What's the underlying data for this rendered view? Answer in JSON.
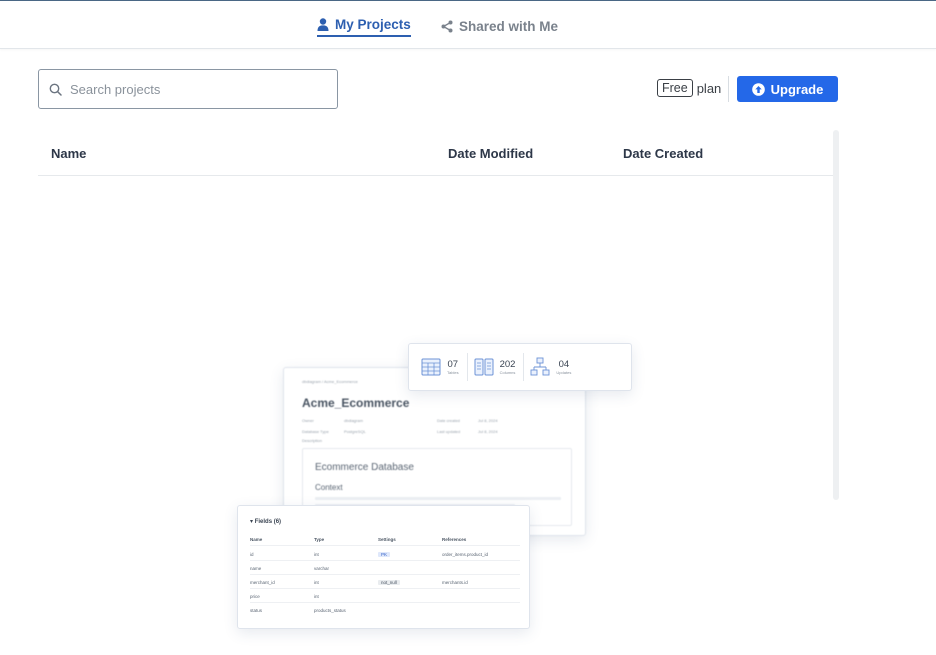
{
  "tabs": [
    {
      "label": "My Projects",
      "icon": "user-icon",
      "active": true
    },
    {
      "label": "Shared with Me",
      "icon": "share-icon",
      "active": false
    }
  ],
  "search": {
    "placeholder": "Search projects",
    "value": ""
  },
  "plan": {
    "badge": "Free",
    "suffix": "plan"
  },
  "upgrade": {
    "label": "Upgrade",
    "icon": "upload-circle-icon"
  },
  "table": {
    "columns": [
      "Name",
      "Date Modified",
      "Date Created"
    ]
  },
  "illustration": {
    "breadcrumb": "dbdiagram / Acme_Ecommerce",
    "project_title": "Acme_Ecommerce",
    "meta": [
      {
        "label": "Owner",
        "value": "dbdiagram"
      },
      {
        "label": "Database Type",
        "value": "PostgreSQL"
      },
      {
        "label": "Description",
        "value": ""
      },
      {
        "label": "Date created",
        "value": "Jul 8, 2024"
      },
      {
        "label": "Last updated",
        "value": "Jul 8, 2024"
      }
    ],
    "doc_title": "Ecommerce Database",
    "doc_subtitle": "Context",
    "stats": [
      {
        "value": "07",
        "label": "Tables"
      },
      {
        "value": "202",
        "label": "Columns"
      },
      {
        "value": "04",
        "label": "Updates"
      }
    ],
    "fields_title": "Fields (6)",
    "fields_header": [
      "Name",
      "Type",
      "Settings",
      "References"
    ],
    "fields": [
      {
        "name": "id",
        "type": "int",
        "settings": "PK",
        "ref": "order_items.product_id"
      },
      {
        "name": "name",
        "type": "varchar",
        "settings": "",
        "ref": ""
      },
      {
        "name": "merchant_id",
        "type": "int",
        "settings": "not_null",
        "ref": "merchants.id"
      },
      {
        "name": "price",
        "type": "int",
        "settings": "",
        "ref": ""
      },
      {
        "name": "status",
        "type": "products_status",
        "settings": "",
        "ref": ""
      }
    ]
  },
  "colors": {
    "accent": "#2468e8",
    "active_tab": "#2d5fb0",
    "inactive_tab": "#7a828c"
  }
}
